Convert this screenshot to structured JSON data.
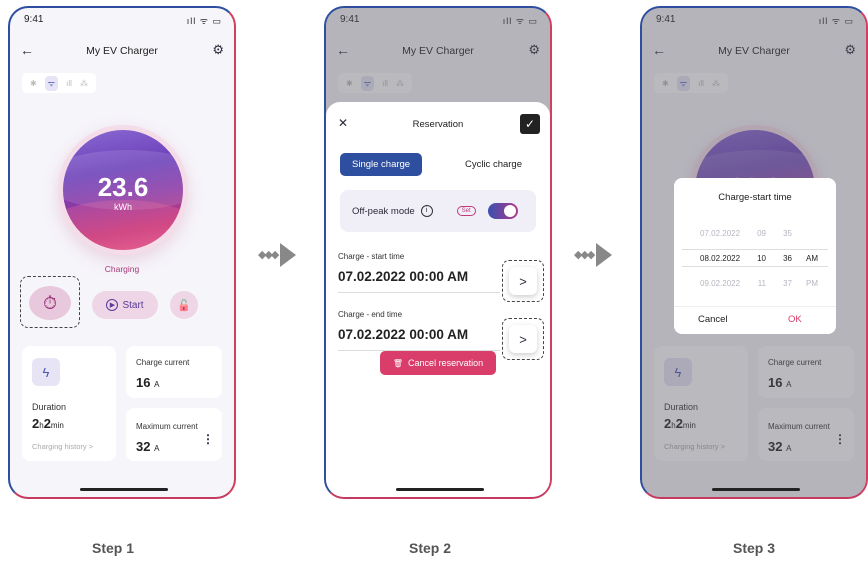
{
  "common": {
    "time": "9:41",
    "status_icons": "ıll ᯤ ▭",
    "back_icon": "←",
    "title": "My EV Charger",
    "gear_icon": "⚙"
  },
  "screen1": {
    "connection_icons": [
      "✱",
      "ᯤ",
      "ıll",
      "⁂"
    ],
    "energy_value": "23.6",
    "energy_unit": "kWh",
    "status": "Charging",
    "timer_icon": "⏱",
    "start_icon": "▶",
    "start_label": "Start",
    "lock_icon": "🔓",
    "bolt_icon": "ϟ",
    "duration_label": "Duration",
    "duration_h": "2",
    "duration_h_unit": "h",
    "duration_m": "2",
    "duration_m_unit": "min",
    "charging_history": "Charging history >",
    "charge_current_label": "Charge current",
    "charge_current_value": "16",
    "charge_current_unit": "A",
    "max_current_label": "Maximum current",
    "max_current_value": "32",
    "max_current_unit": "A",
    "more_icon": "⋮"
  },
  "screen2": {
    "close_icon": "✕",
    "title": "Reservation",
    "confirm_icon": "✓",
    "tab_single": "Single charge",
    "tab_cyclic": "Cyclic charge",
    "offpeak_label": "Off-peak mode",
    "info_icon": "i",
    "set_label": "Set",
    "start_label": "Charge - start time",
    "start_value": "07.02.2022 00:00 AM",
    "end_label": "Charge - end time",
    "end_value": "07.02.2022 00:00 AM",
    "arrow_icon": ">",
    "cancel_icon": "🗑",
    "cancel_label": "Cancel reservation"
  },
  "screen3": {
    "dialog_title": "Charge-start time",
    "rows": [
      {
        "date": "07.02.2022",
        "hour": "09",
        "minute": "35",
        "ampm": ""
      },
      {
        "date": "08.02.2022",
        "hour": "10",
        "minute": "36",
        "ampm": "AM"
      },
      {
        "date": "09.02.2022",
        "hour": "11",
        "minute": "37",
        "ampm": "PM"
      }
    ],
    "cancel": "Cancel",
    "ok": "OK"
  },
  "steps": [
    "Step 1",
    "Step 2",
    "Step 3"
  ],
  "colors": {
    "accent": "#2e4fa0",
    "pink": "#d93d6a",
    "purple": "#6b3fb8"
  }
}
